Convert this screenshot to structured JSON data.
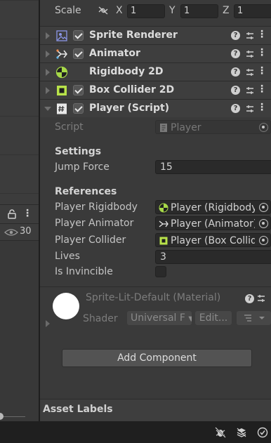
{
  "scene_panel": {
    "visibility_count": "30"
  },
  "transform": {
    "scale_label": "Scale",
    "x_label": "X",
    "x_value": "1",
    "y_label": "Y",
    "y_value": "1",
    "z_label": "Z",
    "z_value": "1"
  },
  "components": [
    {
      "name": "Sprite Renderer",
      "icon": "sprite-renderer-icon",
      "enabled": true
    },
    {
      "name": "Animator",
      "icon": "animator-icon",
      "enabled": true
    },
    {
      "name": "Rigidbody 2D",
      "icon": "rigidbody2d-icon",
      "enabled": null
    },
    {
      "name": "Box Collider 2D",
      "icon": "box-collider-icon",
      "enabled": true
    },
    {
      "name": "Player (Script)",
      "icon": "script-icon",
      "enabled": true
    }
  ],
  "player_script": {
    "script_label": "Script",
    "script_value": "Player",
    "settings_header": "Settings",
    "jump_force_label": "Jump Force",
    "jump_force_value": "15",
    "references_header": "References",
    "player_rigidbody_label": "Player Rigidbody",
    "player_rigidbody_value": "Player (Rigidbody",
    "player_animator_label": "Player Animator",
    "player_animator_value": "Player (Animator)",
    "player_collider_label": "Player Collider",
    "player_collider_value": "Player (Box Collide",
    "lives_label": "Lives",
    "lives_value": "3",
    "is_invincible_label": "Is Invincible",
    "is_invincible_value": false
  },
  "material": {
    "name": "Sprite-Lit-Default (Material)",
    "shader_label": "Shader",
    "shader_value": "Universal F",
    "edit_label": "Edit..."
  },
  "add_component_label": "Add Component",
  "asset_labels_title": "Asset Labels",
  "colors": {
    "rigidbody_icon": "#a6d848",
    "collider_icon": "#b8e24a",
    "sprite_icon": "#7a8ae0"
  }
}
